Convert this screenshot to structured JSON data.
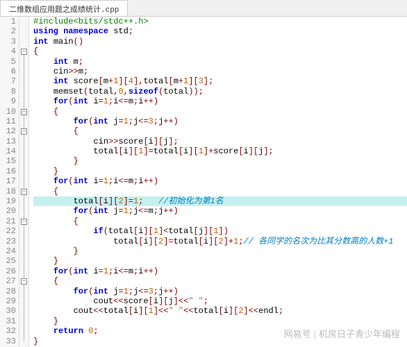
{
  "tab": {
    "title": "二维数组应用题之成绩统计.cpp"
  },
  "lines": {
    "count": 33,
    "l1": {
      "pp": "#include",
      "inc": "<bits/stdc++.h>"
    },
    "l2": {
      "kw1": "using",
      "kw2": "namespace",
      "id": "std",
      "semi": ";"
    },
    "l3": {
      "kw1": "int",
      "fn": "main",
      "p": "()"
    },
    "l4": {
      "b": "{"
    },
    "l5": {
      "kw": "int",
      "id": "m",
      "semi": ";"
    },
    "l6": {
      "id": "cin",
      "op": ">>",
      "v": "m",
      "semi": ";"
    },
    "l7": {
      "kw": "int",
      "a1": "score",
      "d1a": "[",
      "e1": "m",
      "pl1": "+",
      "n1": "1",
      "d1b": "][",
      "n2": "4",
      "d1c": "],",
      "a2": "total",
      "d2a": "[",
      "e2": "m",
      "pl2": "+",
      "n3": "1",
      "d2b": "][",
      "n4": "3",
      "d2c": "];"
    },
    "l8": {
      "fn": "memset",
      "p1": "(",
      "a": "total",
      "c1": ",",
      "z": "0",
      "c2": ",",
      "kw": "sizeof",
      "p2": "(",
      "b": "total",
      "p3": "));"
    },
    "l9": {
      "kw": "for",
      "p1": "(",
      "kw2": "int",
      "v": "i",
      "eq": "=",
      "n1": "1",
      "semi1": ";",
      "v2": "i",
      "op": "<=",
      "m": "m",
      "semi2": ";",
      "v3": "i",
      "inc": "++",
      "p2": ")"
    },
    "l10": {
      "b": "{"
    },
    "l11": {
      "kw": "for",
      "p1": "(",
      "kw2": "int",
      "v": "j",
      "eq": "=",
      "n1": "1",
      "semi1": ";",
      "v2": "j",
      "op": "<=",
      "n2": "3",
      "semi2": ";",
      "v3": "j",
      "inc": "++",
      "p2": ")"
    },
    "l12": {
      "b": "{"
    },
    "l13": {
      "id": "cin",
      "op": ">>",
      "a": "score",
      "d1": "[",
      "i": "i",
      "d2": "][",
      "j": "j",
      "d3": "];"
    },
    "l14": {
      "lhs": "total",
      "d1": "[",
      "i": "i",
      "d2": "][",
      "n1": "1",
      "d3": "]=",
      "rhs1": "total",
      "d4": "[",
      "i2": "i",
      "d5": "][",
      "n2": "1",
      "d6": "]+",
      "rhs2": "score",
      "d7": "[",
      "i3": "i",
      "d8": "][",
      "j": "j",
      "d9": "];"
    },
    "l15": {
      "b": "}"
    },
    "l16": {
      "b": "}"
    },
    "l17": {
      "kw": "for",
      "p1": "(",
      "kw2": "int",
      "v": "i",
      "eq": "=",
      "n1": "1",
      "semi1": ";",
      "v2": "i",
      "op": "<=",
      "m": "m",
      "semi2": ";",
      "v3": "i",
      "inc": "++",
      "p2": ")"
    },
    "l18": {
      "b": "{"
    },
    "l19": {
      "lhs": "total",
      "d1": "[",
      "i": "i",
      "d2": "][",
      "n1": "2",
      "d3": "]=",
      "n2": "1",
      "semi": ";",
      "cm": "   //初始化为第1名"
    },
    "l20": {
      "kw": "for",
      "p1": "(",
      "kw2": "int",
      "v": "j",
      "eq": "=",
      "n1": "1",
      "semi1": ";",
      "v2": "j",
      "op": "<=",
      "m": "m",
      "semi2": ";",
      "v3": "j",
      "inc": "++",
      "p2": ")"
    },
    "l21": {
      "b": "{"
    },
    "l22": {
      "kw": "if",
      "p1": "(",
      "a": "total",
      "d1": "[",
      "i": "i",
      "d2": "][",
      "n1": "1",
      "d3": "]<",
      "b": "total",
      "d4": "[",
      "j": "j",
      "d5": "][",
      "n2": "1",
      "d6": "])"
    },
    "l23": {
      "lhs": "total",
      "d1": "[",
      "i": "i",
      "d2": "][",
      "n1": "2",
      "d3": "]=",
      "rhs": "total",
      "d4": "[",
      "i2": "i",
      "d5": "][",
      "n2": "2",
      "d6": "]+",
      "n3": "1",
      "semi": ";",
      "cm": "// 各同学的名次为比其分数高的人数+1"
    },
    "l24": {
      "b": "}"
    },
    "l25": {
      "b": "}"
    },
    "l26": {
      "kw": "for",
      "p1": "(",
      "kw2": "int",
      "v": "i",
      "eq": "=",
      "n1": "1",
      "semi1": ";",
      "v2": "i",
      "op": "<=",
      "m": "m",
      "semi2": ";",
      "v3": "i",
      "inc": "++",
      "p2": ")"
    },
    "l27": {
      "b": "{"
    },
    "l28": {
      "kw": "for",
      "p1": "(",
      "kw2": "int",
      "v": "j",
      "eq": "=",
      "n1": "1",
      "semi1": ";",
      "v2": "j",
      "op": "<=",
      "n2": "3",
      "semi2": ";",
      "v3": "j",
      "inc": "++",
      "p2": ")"
    },
    "l29": {
      "id": "cout",
      "op": "<<",
      "a": "score",
      "d1": "[",
      "i": "i",
      "d2": "][",
      "j": "j",
      "d3": "]<<",
      "s": "\" \"",
      "semi": ";"
    },
    "l30": {
      "id": "cout",
      "op": "<<",
      "a": "total",
      "d1": "[",
      "i": "i",
      "d2": "][",
      "n1": "1",
      "d3": "]<<",
      "s": "\" \"",
      "op2": "<<",
      "b": "total",
      "d4": "[",
      "i2": "i",
      "d5": "][",
      "n2": "2",
      "d6": "]<<",
      "e": "endl",
      "semi": ";"
    },
    "l31": {
      "b": "}"
    },
    "l32": {
      "kw": "return",
      "n": "0",
      "semi": ";"
    },
    "l33": {
      "b": "}"
    }
  },
  "watermark": {
    "brand": "网易号",
    "author": "机房日子青少年编程"
  }
}
